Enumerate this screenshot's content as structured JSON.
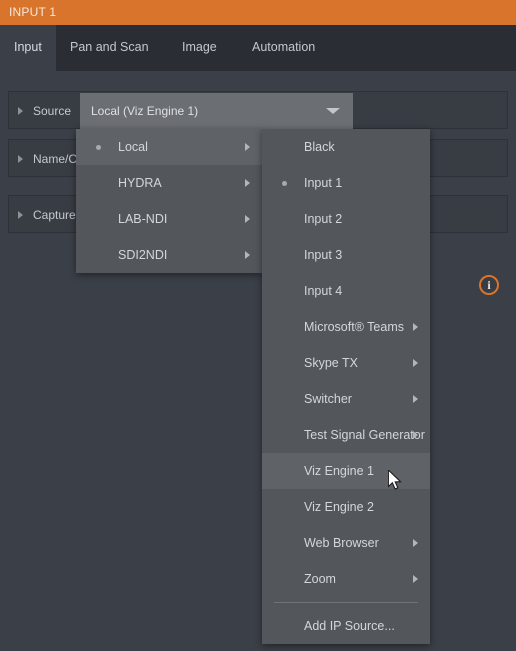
{
  "window": {
    "title": "INPUT 1",
    "title_bar_color": "#d9742c"
  },
  "tabs": [
    {
      "label": "Input",
      "active": true
    },
    {
      "label": "Pan and Scan",
      "active": false
    },
    {
      "label": "Image",
      "active": false
    },
    {
      "label": "Automation",
      "active": false
    }
  ],
  "properties": {
    "source": {
      "label": "Source",
      "combo_value": "Local (Viz Engine 1)"
    },
    "name_color": {
      "label": "Name/C"
    },
    "capture": {
      "label": "Capture",
      "info_glyph": "i"
    }
  },
  "menus": {
    "level1": [
      {
        "label": "Local",
        "selected": true,
        "has_submenu": true,
        "highlight": true
      },
      {
        "label": "HYDRA",
        "selected": false,
        "has_submenu": true,
        "highlight": false
      },
      {
        "label": "LAB-NDI",
        "selected": false,
        "has_submenu": true,
        "highlight": false
      },
      {
        "label": "SDI2NDI",
        "selected": false,
        "has_submenu": true,
        "highlight": false
      }
    ],
    "level2": [
      {
        "label": "Black",
        "selected": false,
        "has_submenu": false,
        "highlight": false,
        "separator_before": false
      },
      {
        "label": "Input 1",
        "selected": true,
        "has_submenu": false,
        "highlight": false,
        "separator_before": false
      },
      {
        "label": "Input 2",
        "selected": false,
        "has_submenu": false,
        "highlight": false,
        "separator_before": false
      },
      {
        "label": "Input 3",
        "selected": false,
        "has_submenu": false,
        "highlight": false,
        "separator_before": false
      },
      {
        "label": "Input 4",
        "selected": false,
        "has_submenu": false,
        "highlight": false,
        "separator_before": false
      },
      {
        "label": "Microsoft® Teams",
        "selected": false,
        "has_submenu": true,
        "highlight": false,
        "separator_before": false
      },
      {
        "label": "Skype TX",
        "selected": false,
        "has_submenu": true,
        "highlight": false,
        "separator_before": false
      },
      {
        "label": "Switcher",
        "selected": false,
        "has_submenu": true,
        "highlight": false,
        "separator_before": false
      },
      {
        "label": "Test Signal Generator",
        "selected": false,
        "has_submenu": true,
        "highlight": false,
        "separator_before": false
      },
      {
        "label": "Viz Engine 1",
        "selected": false,
        "has_submenu": false,
        "highlight": true,
        "separator_before": false
      },
      {
        "label": "Viz Engine 2",
        "selected": false,
        "has_submenu": false,
        "highlight": false,
        "separator_before": false
      },
      {
        "label": "Web Browser",
        "selected": false,
        "has_submenu": true,
        "highlight": false,
        "separator_before": false
      },
      {
        "label": "Zoom",
        "selected": false,
        "has_submenu": true,
        "highlight": false,
        "separator_before": false
      },
      {
        "label": "Add IP Source...",
        "selected": false,
        "has_submenu": false,
        "highlight": false,
        "separator_before": true
      }
    ]
  },
  "colors": {
    "accent": "#d9742c",
    "panel_bg": "#3b4048",
    "tabbar_bg": "#2a2d33",
    "menu_bg": "#53575c",
    "menu_highlight": "#5f6368",
    "combo_bg": "#6b6e72"
  }
}
